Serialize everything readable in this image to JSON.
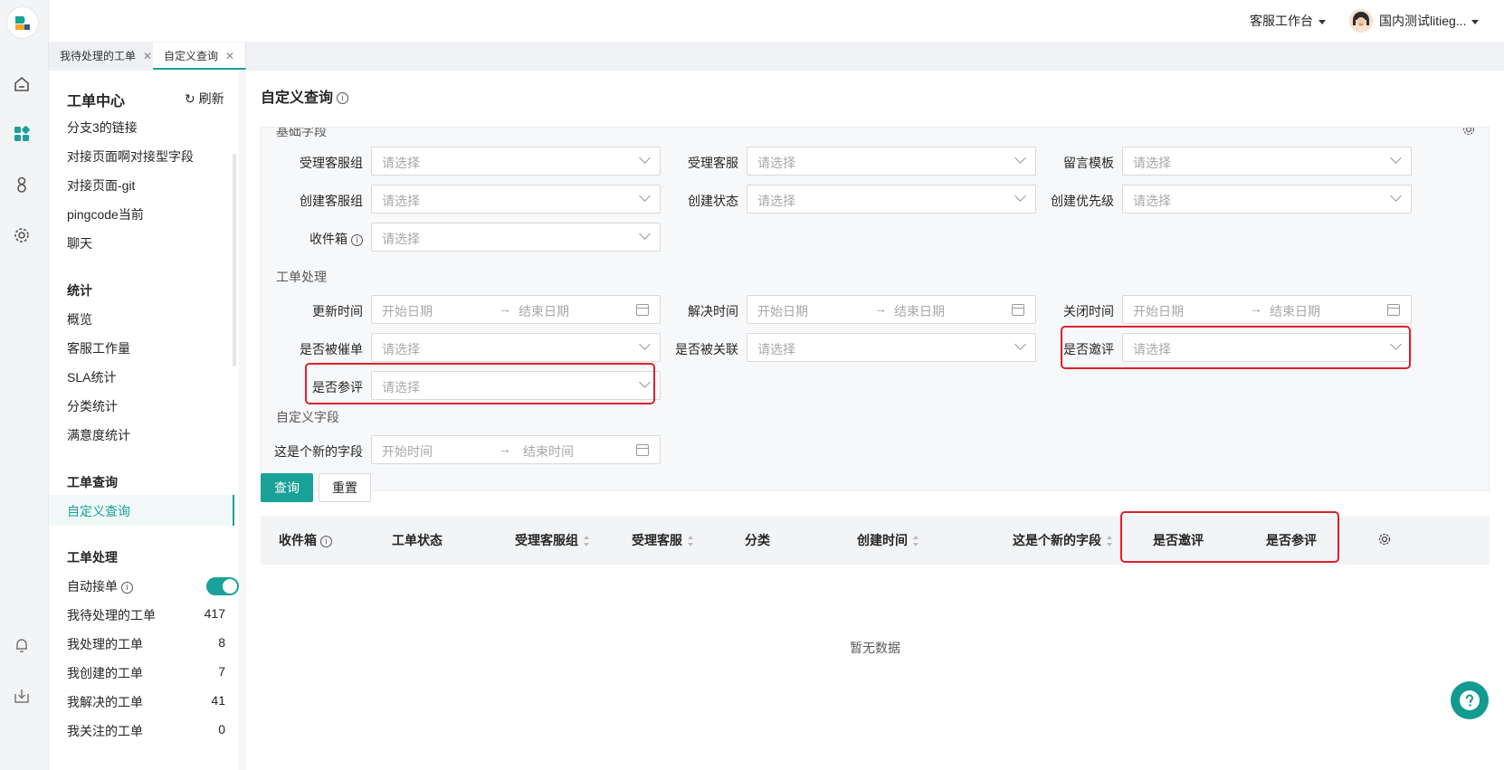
{
  "topbar": {
    "workspace": "客服工作台",
    "user": "国内测试litieg..."
  },
  "tabs": [
    {
      "label": "我待处理的工单"
    },
    {
      "label": "自定义查询"
    }
  ],
  "sidebar": {
    "title": "工单中心",
    "refresh": "刷新",
    "items_top": [
      "分支3的链接",
      "对接页面啊对接型字段",
      "对接页面-git",
      "pingcode当前",
      "聊天"
    ],
    "stats_head": "统计",
    "stats": [
      "概览",
      "客服工作量",
      "SLA统计",
      "分类统计",
      "满意度统计"
    ],
    "query_head": "工单查询",
    "query_active": "自定义查询",
    "process_head": "工单处理",
    "auto_accept": "自动接单",
    "counts": [
      {
        "label": "我待处理的工单",
        "count": "417"
      },
      {
        "label": "我处理的工单",
        "count": "8"
      },
      {
        "label": "我创建的工单",
        "count": "7"
      },
      {
        "label": "我解决的工单",
        "count": "41"
      },
      {
        "label": "我关注的工单",
        "count": "0"
      }
    ]
  },
  "page": {
    "title": "自定义查询"
  },
  "filters": {
    "basic_section": "基础字段",
    "process_section": "工单处理",
    "custom_section": "自定义字段",
    "placeholder": "请选择",
    "start_date": "开始日期",
    "end_date": "结束日期",
    "start_time": "开始时间",
    "end_time": "结束时间",
    "f1": "受理客服组",
    "f2": "受理客服",
    "f3": "留言模板",
    "f4": "创建客服组",
    "f5": "创建状态",
    "f6": "创建优先级",
    "f7": "收件箱",
    "f8": "更新时间",
    "f9": "解决时间",
    "f10": "关闭时间",
    "f11": "是否被催单",
    "f12": "是否被关联",
    "f13": "是否邀评",
    "f14": "是否参评",
    "f15": "这是个新的字段"
  },
  "actions": {
    "query": "查询",
    "reset": "重置"
  },
  "table": {
    "columns": [
      "收件箱",
      "工单状态",
      "受理客服组",
      "受理客服",
      "分类",
      "创建时间",
      "这是个新的字段",
      "是否邀评",
      "是否参评"
    ],
    "empty": "暂无数据"
  },
  "colors": {
    "accent": "#1aa198",
    "highlight": "#e0202a"
  }
}
